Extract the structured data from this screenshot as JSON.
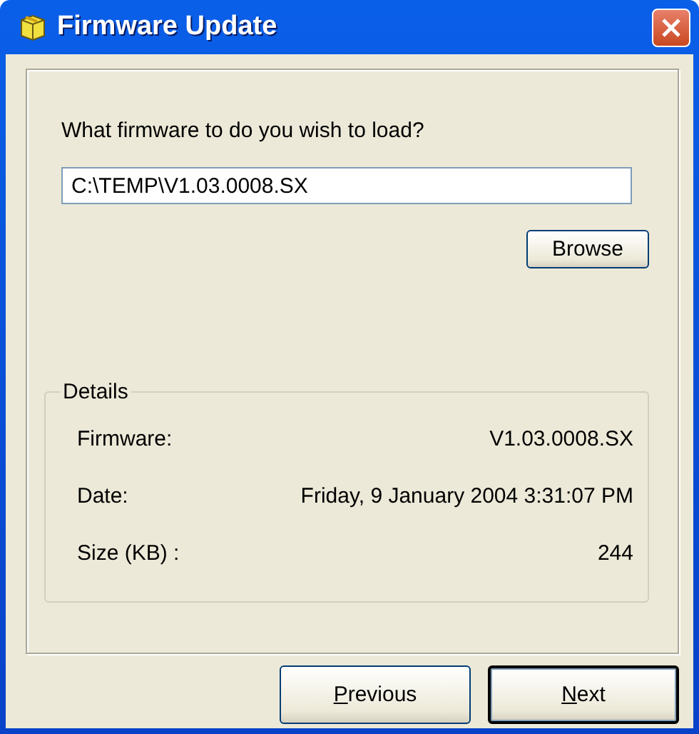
{
  "window": {
    "title": "Firmware Update"
  },
  "prompt": "What firmware to do you wish to load?",
  "file_field": {
    "value": "C:\\TEMP\\V1.03.0008.SX"
  },
  "browse_button": {
    "label": "Browse"
  },
  "details": {
    "title": "Details",
    "rows": [
      {
        "label": "Firmware:",
        "value": "V1.03.0008.SX"
      },
      {
        "label": "Date:",
        "value": "Friday, 9 January 2004 3:31:07 PM"
      },
      {
        "label": "Size (KB) :",
        "value": "244"
      }
    ]
  },
  "buttons": [
    {
      "label": "Previous",
      "default": false
    },
    {
      "label": "Next",
      "default": true
    }
  ]
}
